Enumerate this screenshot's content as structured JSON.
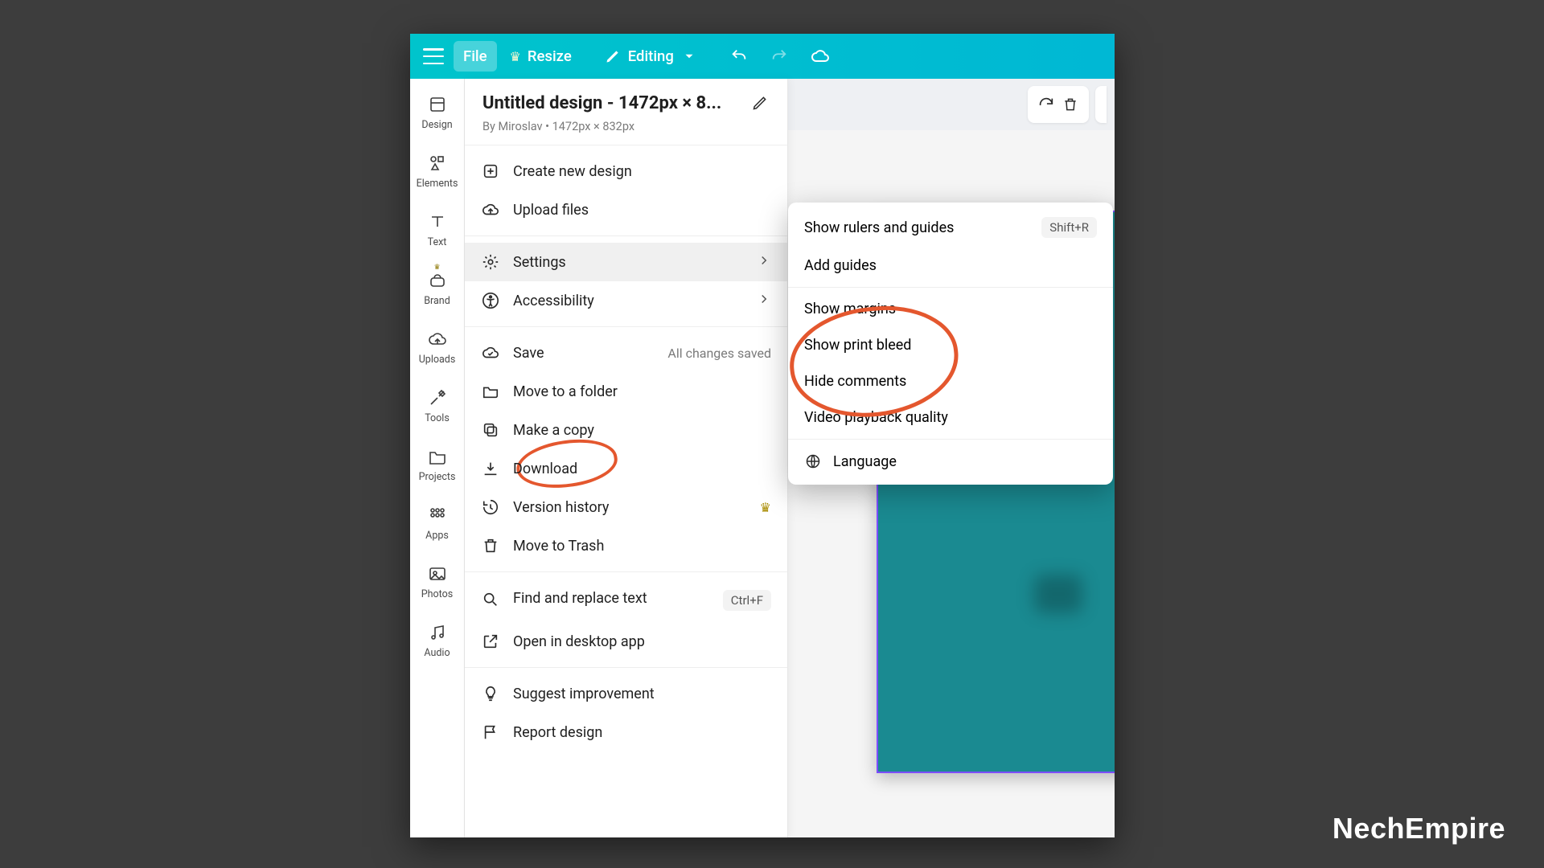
{
  "topbar": {
    "file": "File",
    "resize": "Resize",
    "editing": "Editing"
  },
  "sidebar": {
    "items": [
      {
        "label": "Design"
      },
      {
        "label": "Elements"
      },
      {
        "label": "Text"
      },
      {
        "label": "Brand"
      },
      {
        "label": "Uploads"
      },
      {
        "label": "Tools"
      },
      {
        "label": "Projects"
      },
      {
        "label": "Apps"
      },
      {
        "label": "Photos"
      },
      {
        "label": "Audio"
      }
    ]
  },
  "file_panel": {
    "title": "Untitled design - 1472px × 8...",
    "subtitle": "By Miroslav • 1472px × 832px",
    "create": "Create new design",
    "upload": "Upload files",
    "settings": "Settings",
    "accessibility": "Accessibility",
    "save": "Save",
    "save_status": "All changes saved",
    "move": "Move to a folder",
    "copy": "Make a copy",
    "download": "Download",
    "version": "Version history",
    "trash": "Move to Trash",
    "find": "Find and replace text",
    "find_kbd": "Ctrl+F",
    "desktop": "Open in desktop app",
    "suggest": "Suggest improvement",
    "report": "Report design"
  },
  "settings_panel": {
    "rulers": "Show rulers and guides",
    "rulers_kbd": "Shift+R",
    "guides": "Add guides",
    "margins": "Show margins",
    "bleed": "Show print bleed",
    "comments": "Hide comments",
    "video": "Video playback quality",
    "language": "Language"
  },
  "watermark": "NechEmpire"
}
